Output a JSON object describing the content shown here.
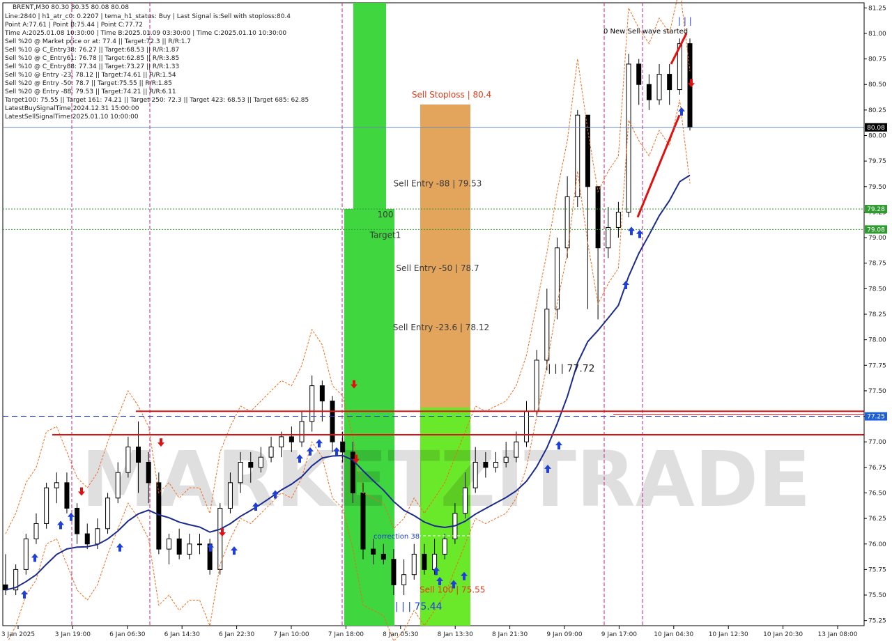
{
  "header": {
    "symbol_line": "BRENT,M30  80.30 80.35 80.08 80.08",
    "lines": [
      "Line:2840  |  h1_atr_c0: 0.2207  |  tema_h1_status: Buy  |  Last Signal is:Sell with stoploss:80.4",
      "Point A:77.61  |  Point B:75.44  |  Point C:77.72",
      "Time A:2025.01.08 10:30:00  |  Time B:2025.01.09 03:30:00  |  Time C:2025.01.10 10:30:00",
      "Sell %20 @ Market price or at: 77.4  ||  Target:72.3  ||  R/R:1.7",
      "Sell %10 @ C_Entry38: 76.27  ||  Target:68.53  ||  R/R:1.87",
      "Sell %10 @ C_Entry61: 76.78  ||  Target:62.85  ||  R/R:3.85",
      "Sell %10 @ C_Entry88: 77.34  ||  Target:73.27  ||  R/R:1.33",
      "Sell %10 @ Entry -23: 78.12  ||  Target:74.61  ||  R/R:1.54",
      "Sell %20 @ Entry -50: 78.7  ||  Target:75.55  ||  R/R:1.85",
      "Sell %20 @ Entry -88: 79.53  ||  Target:74.21  ||  R/R:6.11",
      "Target100: 75.55  ||  Target 161: 74.21  ||  Target 250: 72.3  ||  Target 423: 68.53  ||  Target 685: 62.85",
      "LatestBuySignalTime:2024.12.31 15:00:00",
      "LatestSellSignalTime:2025.01.10 10:00:00"
    ]
  },
  "chart_data": {
    "type": "candlestick",
    "symbol": "BRENT",
    "timeframe": "M30",
    "ylim": [
      75.2,
      81.3
    ],
    "y_ticks": [
      "81.25",
      "81.00",
      "80.75",
      "80.50",
      "80.25",
      "80.00",
      "79.75",
      "79.50",
      "79.25",
      "79.00",
      "78.75",
      "78.50",
      "78.25",
      "78.00",
      "77.75",
      "77.50",
      "77.25",
      "77.00",
      "76.75",
      "76.50",
      "76.25",
      "76.00",
      "75.75",
      "75.50",
      "75.25"
    ],
    "x_ticks": [
      "3 Jan 2025",
      "3 Jan 19:00",
      "6 Jan 06:30",
      "6 Jan 14:30",
      "6 Jan 22:30",
      "7 Jan 10:00",
      "7 Jan 18:00",
      "8 Jan 05:30",
      "8 Jan 13:30",
      "8 Jan 21:30",
      "9 Jan 09:00",
      "9 Jan 17:00",
      "10 Jan 04:30",
      "10 Jan 12:30",
      "10 Jan 20:30",
      "13 Jan 08:00"
    ],
    "price_badges": [
      {
        "value": "80.08",
        "color": "#000000"
      },
      {
        "value": "79.28",
        "color": "#2e9c2e"
      },
      {
        "value": "79.08",
        "color": "#2e9c2e"
      },
      {
        "value": "77.25",
        "color": "#1f5fd6"
      }
    ],
    "levels": [
      {
        "name": "Sell Stoploss",
        "value": 80.4,
        "label": "Sell Stoploss | 80.4",
        "color": "#e23b1a"
      },
      {
        "name": "Sell Entry -88",
        "value": 79.53,
        "label": "Sell Entry -88 | 79.53",
        "color": "#3a3a3a"
      },
      {
        "name": "100",
        "value": 79.28,
        "label": "100",
        "color": "#3a3a3a"
      },
      {
        "name": "Target1",
        "value": 79.08,
        "label": "Target1",
        "color": "#3a3a3a"
      },
      {
        "name": "Sell Entry -50",
        "value": 78.7,
        "label": "Sell Entry -50 | 78.7",
        "color": "#3a3a3a"
      },
      {
        "name": "Sell Entry -23.6",
        "value": 78.12,
        "label": "Sell Entry -23.6 | 78.12",
        "color": "#3a3a3a"
      },
      {
        "name": "Point C",
        "value": 77.72,
        "label": "| | | 77.72",
        "color": "#222222"
      },
      {
        "name": "correction 38",
        "value": 76.08,
        "label": "correction 38",
        "color": "#1f3fd6"
      },
      {
        "name": "Sell 100",
        "value": 75.55,
        "label": "Sell 100 | 75.55",
        "color": "#e23b1a"
      },
      {
        "name": "Point B",
        "value": 75.44,
        "label": "| | | 75.44",
        "color": "#1f3fd6"
      }
    ],
    "annotations": {
      "wave_started": "0 New Sell wave started",
      "top_marks": "| | |"
    },
    "watermark": "MARKETZITRADE",
    "candles_approx": [
      [
        0,
        75.6,
        75.55,
        75.9,
        75.5
      ],
      [
        1,
        75.55,
        75.75,
        75.8,
        75.5
      ],
      [
        2,
        75.75,
        76.05,
        76.1,
        75.7
      ],
      [
        3,
        76.05,
        76.2,
        76.3,
        76.0
      ],
      [
        4,
        76.2,
        76.55,
        76.6,
        76.15
      ],
      [
        5,
        76.55,
        76.6,
        76.7,
        76.4
      ],
      [
        6,
        76.6,
        76.35,
        76.7,
        76.3
      ],
      [
        7,
        76.35,
        76.1,
        76.4,
        76.0
      ],
      [
        8,
        76.1,
        76.0,
        76.2,
        75.95
      ],
      [
        9,
        76.0,
        76.15,
        76.25,
        75.95
      ],
      [
        10,
        76.15,
        76.45,
        76.5,
        76.1
      ],
      [
        11,
        76.45,
        76.7,
        76.8,
        76.4
      ],
      [
        12,
        76.7,
        76.95,
        77.05,
        76.65
      ],
      [
        13,
        76.95,
        76.8,
        77.2,
        76.5
      ],
      [
        14,
        76.8,
        76.6,
        76.9,
        76.4
      ],
      [
        15,
        76.6,
        75.95,
        76.7,
        75.9
      ],
      [
        16,
        75.95,
        76.05,
        76.1,
        75.8
      ],
      [
        17,
        76.05,
        75.9,
        76.15,
        75.85
      ],
      [
        18,
        75.9,
        76.0,
        76.1,
        75.85
      ],
      [
        19,
        76.0,
        76.0,
        76.1,
        75.9
      ],
      [
        20,
        76.0,
        75.75,
        76.05,
        75.7
      ],
      [
        21,
        75.75,
        76.35,
        76.4,
        75.7
      ],
      [
        22,
        76.35,
        76.6,
        76.7,
        76.3
      ],
      [
        23,
        76.6,
        76.8,
        76.9,
        76.5
      ],
      [
        24,
        76.8,
        76.75,
        76.9,
        76.6
      ],
      [
        25,
        76.75,
        76.85,
        76.95,
        76.7
      ],
      [
        26,
        76.85,
        76.95,
        77.05,
        76.8
      ],
      [
        27,
        76.95,
        77.05,
        77.1,
        76.85
      ],
      [
        28,
        77.05,
        77.0,
        77.15,
        76.9
      ],
      [
        29,
        77.0,
        77.2,
        77.3,
        76.95
      ],
      [
        30,
        77.2,
        77.55,
        77.65,
        77.1
      ],
      [
        31,
        77.55,
        77.4,
        77.6,
        77.2
      ],
      [
        32,
        77.4,
        77.0,
        77.45,
        76.9
      ],
      [
        33,
        77.0,
        76.9,
        77.1,
        76.8
      ],
      [
        34,
        76.9,
        76.5,
        77.0,
        76.4
      ],
      [
        35,
        76.5,
        75.95,
        76.6,
        75.85
      ],
      [
        36,
        75.95,
        75.9,
        76.05,
        75.8
      ],
      [
        37,
        75.9,
        75.85,
        76.0,
        75.8
      ],
      [
        38,
        75.85,
        75.6,
        75.95,
        75.5
      ],
      [
        39,
        75.6,
        75.7,
        75.85,
        75.5
      ],
      [
        40,
        75.7,
        75.9,
        76.0,
        75.65
      ],
      [
        41,
        75.9,
        75.75,
        76.0,
        75.7
      ],
      [
        42,
        75.75,
        75.9,
        76.05,
        75.7
      ],
      [
        43,
        75.9,
        76.05,
        76.1,
        75.85
      ],
      [
        44,
        76.05,
        76.3,
        76.4,
        76.0
      ],
      [
        45,
        76.3,
        76.55,
        76.7,
        76.25
      ],
      [
        46,
        76.55,
        76.8,
        76.95,
        76.5
      ],
      [
        47,
        76.8,
        76.75,
        76.9,
        76.65
      ],
      [
        48,
        76.75,
        76.8,
        76.9,
        76.7
      ],
      [
        49,
        76.8,
        76.85,
        77.0,
        76.75
      ],
      [
        50,
        76.85,
        77.0,
        77.1,
        76.8
      ],
      [
        51,
        77.0,
        77.3,
        77.4,
        76.95
      ],
      [
        52,
        77.3,
        77.8,
        77.9,
        77.25
      ],
      [
        53,
        77.8,
        78.3,
        78.5,
        77.7
      ],
      [
        54,
        78.3,
        78.9,
        79.0,
        78.2
      ],
      [
        55,
        78.9,
        79.4,
        79.6,
        78.8
      ],
      [
        56,
        79.4,
        80.2,
        80.25,
        79.3
      ],
      [
        57,
        80.2,
        79.5,
        79.6,
        78.3
      ],
      [
        58,
        79.5,
        78.9,
        79.1,
        78.2
      ],
      [
        59,
        78.9,
        79.1,
        79.3,
        78.8
      ],
      [
        60,
        79.1,
        79.25,
        79.35,
        79.0
      ],
      [
        61,
        79.25,
        80.7,
        80.8,
        79.2
      ],
      [
        62,
        80.7,
        80.5,
        80.75,
        80.3
      ],
      [
        63,
        80.5,
        80.35,
        80.6,
        80.25
      ],
      [
        64,
        80.35,
        80.6,
        80.7,
        80.3
      ],
      [
        65,
        80.6,
        80.45,
        80.7,
        80.3
      ],
      [
        66,
        80.45,
        80.9,
        80.95,
        80.4
      ],
      [
        67,
        80.9,
        80.08,
        80.95,
        80.05
      ]
    ]
  }
}
